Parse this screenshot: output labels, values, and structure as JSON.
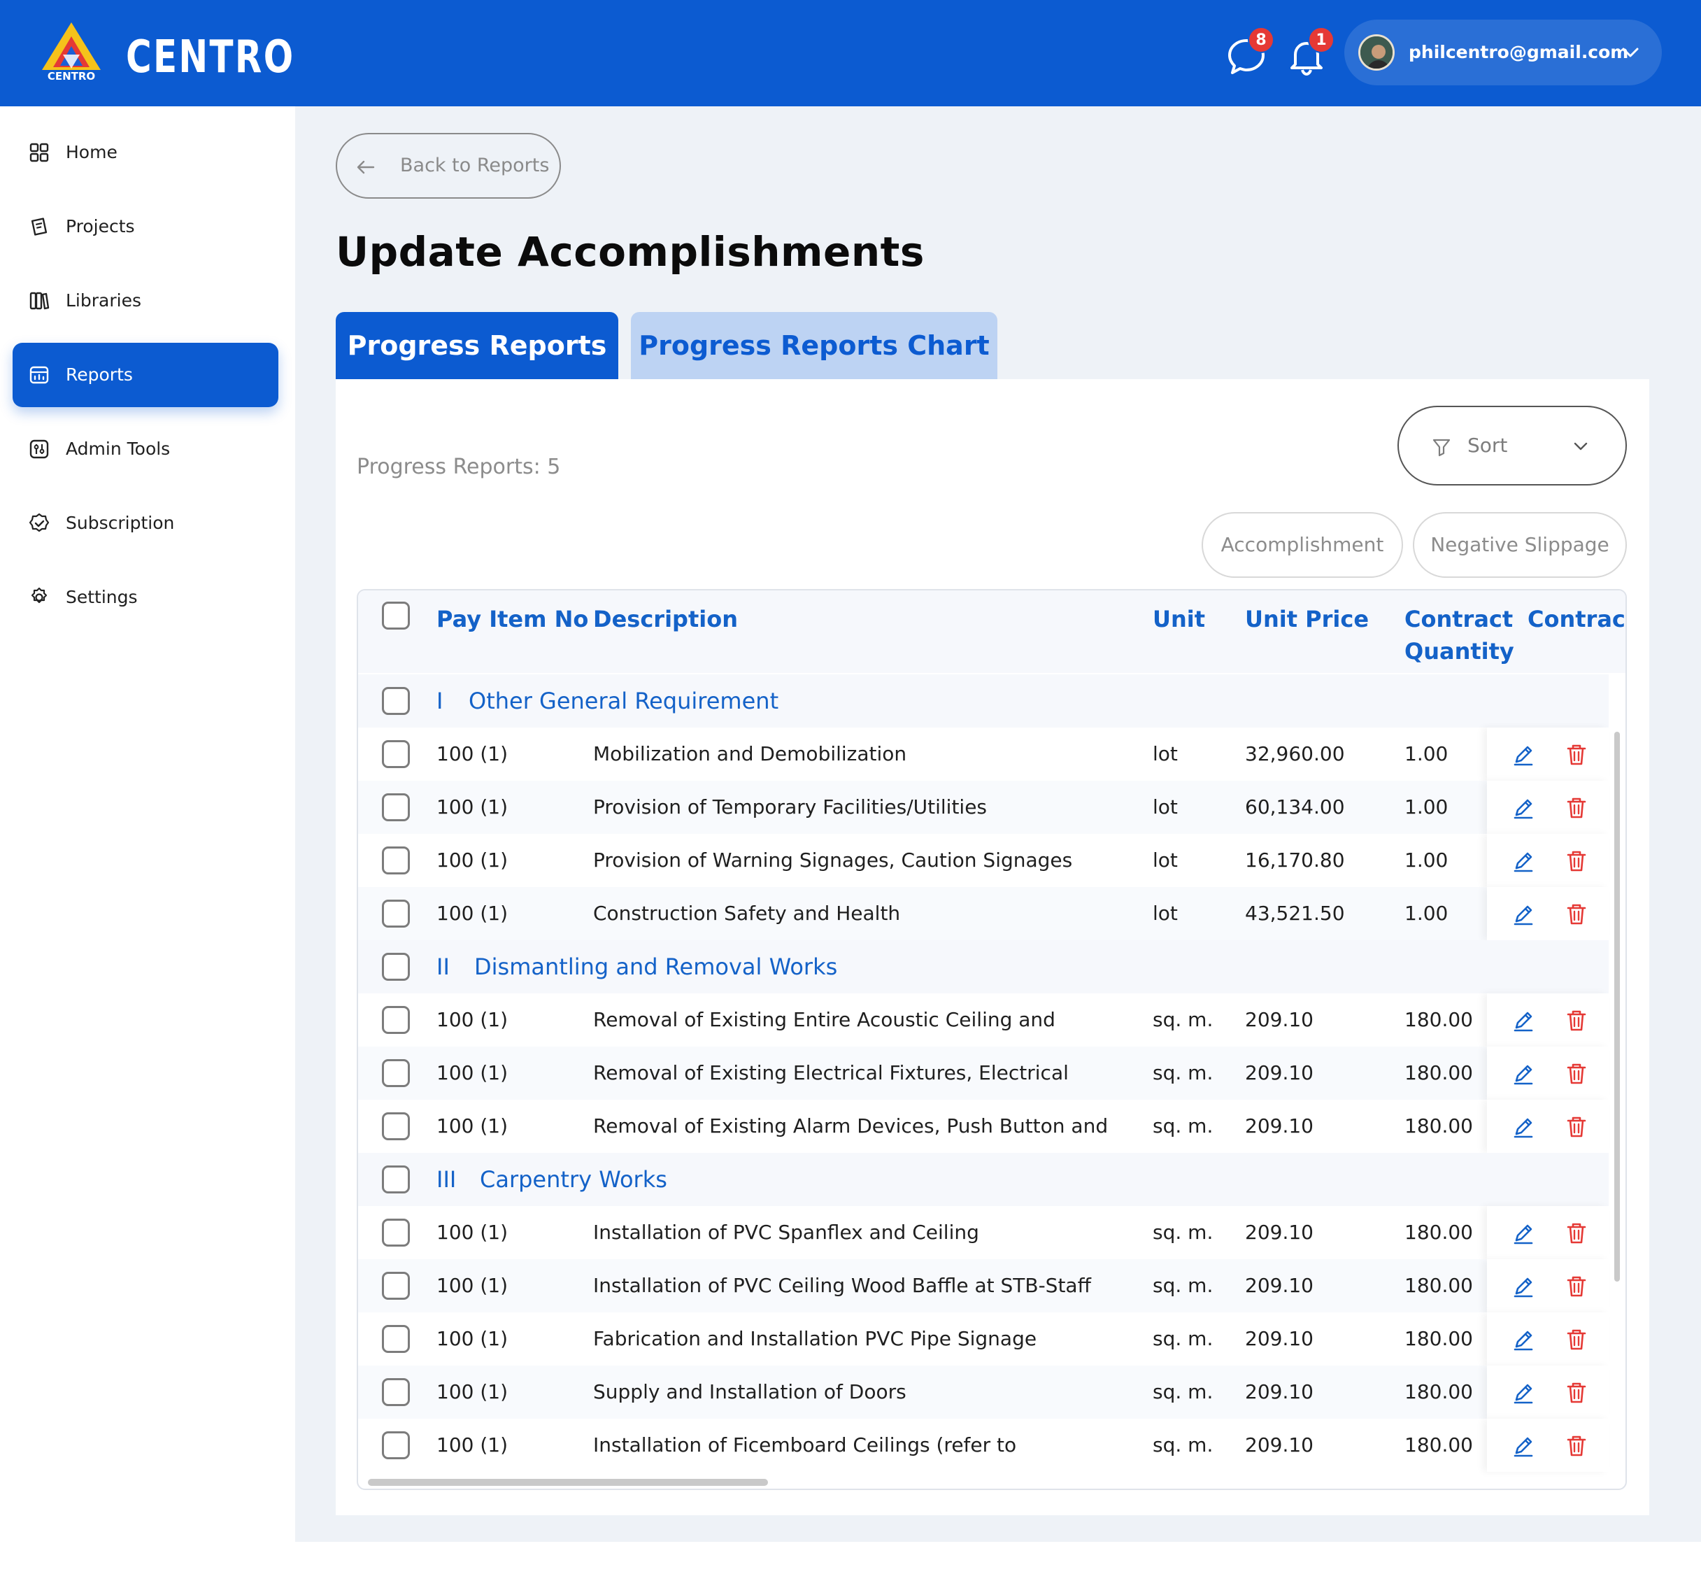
{
  "app": {
    "brand": "CENTRO",
    "logo_text": "CENTRO",
    "colors": {
      "primary": "#0c5bd1",
      "tab_inactive": "#bdd3f3",
      "danger": "#e53935",
      "link_blue": "#1462c8"
    }
  },
  "header": {
    "messages_badge": "8",
    "notifications_badge": "1",
    "user_email": "philcentro@gmail.com",
    "icons": {
      "messages": "chat-bubble-icon",
      "notifications": "bell-icon",
      "menu": "chevron-down-icon"
    }
  },
  "sidebar": {
    "items": [
      {
        "label": "Home",
        "icon": "grid-icon",
        "active": false
      },
      {
        "label": "Projects",
        "icon": "projects-icon",
        "active": false
      },
      {
        "label": "Libraries",
        "icon": "books-icon",
        "active": false
      },
      {
        "label": "Reports",
        "icon": "reports-icon",
        "active": true
      },
      {
        "label": "Admin Tools",
        "icon": "admin-tools-icon",
        "active": false
      },
      {
        "label": "Subscription",
        "icon": "badge-check-icon",
        "active": false
      },
      {
        "label": "Settings",
        "icon": "gear-icon",
        "active": false
      }
    ]
  },
  "main": {
    "back_label": "Back to Reports",
    "title": "Update Accomplishments",
    "tabs": [
      {
        "label": "Progress Reports",
        "active": true
      },
      {
        "label": "Progress Reports Chart",
        "active": false
      }
    ],
    "count_label": "Progress Reports: 5",
    "sort_label": "Sort",
    "filter_buttons": [
      "Accomplishment",
      "Negative Slippage"
    ]
  },
  "table": {
    "headers": {
      "pay_item_no": "Pay Item No",
      "description": "Description",
      "unit": "Unit",
      "unit_price": "Unit Price",
      "contract_quantity_1": "Contract",
      "contract_quantity_2": "Quantity",
      "contract_cut": "Contract"
    },
    "groups": [
      {
        "num": "I",
        "title": "Other General Requirement",
        "rows": [
          {
            "pay_item": "100 (1)",
            "description": "Mobilization and Demobilization",
            "unit": "lot",
            "unit_price": "32,960.00",
            "qty": "1.00"
          },
          {
            "pay_item": "100 (1)",
            "description": "Provision of Temporary Facilities/Utilities",
            "unit": "lot",
            "unit_price": "60,134.00",
            "qty": "1.00"
          },
          {
            "pay_item": "100 (1)",
            "description": "Provision of Warning Signages, Caution Signages",
            "unit": "lot",
            "unit_price": "16,170.80",
            "qty": "1.00"
          },
          {
            "pay_item": "100 (1)",
            "description": "Construction Safety and Health",
            "unit": "lot",
            "unit_price": "43,521.50",
            "qty": "1.00"
          }
        ]
      },
      {
        "num": "II",
        "title": "Dismantling and Removal Works",
        "rows": [
          {
            "pay_item": "100 (1)",
            "description": "Removal of Existing Entire Acoustic Ceiling and",
            "unit": "sq. m.",
            "unit_price": "209.10",
            "qty": "180.00"
          },
          {
            "pay_item": "100 (1)",
            "description": "Removal of Existing Electrical Fixtures, Electrical",
            "unit": "sq. m.",
            "unit_price": "209.10",
            "qty": "180.00"
          },
          {
            "pay_item": "100 (1)",
            "description": "Removal of Existing Alarm Devices, Push Button and",
            "unit": "sq. m.",
            "unit_price": "209.10",
            "qty": "180.00"
          }
        ]
      },
      {
        "num": "III",
        "title": "Carpentry Works",
        "rows": [
          {
            "pay_item": "100 (1)",
            "description": "Installation of PVC Spanflex and Ceiling",
            "unit": "sq. m.",
            "unit_price": "209.10",
            "qty": "180.00"
          },
          {
            "pay_item": "100 (1)",
            "description": "Installation of PVC Ceiling Wood Baffle at STB-Staff",
            "unit": "sq. m.",
            "unit_price": "209.10",
            "qty": "180.00"
          },
          {
            "pay_item": "100 (1)",
            "description": "Fabrication and Installation PVC Pipe Signage",
            "unit": "sq. m.",
            "unit_price": "209.10",
            "qty": "180.00"
          },
          {
            "pay_item": "100 (1)",
            "description": "Supply and Installation of Doors",
            "unit": "sq. m.",
            "unit_price": "209.10",
            "qty": "180.00"
          },
          {
            "pay_item": "100 (1)",
            "description": "Installation of Ficemboard Ceilings (refer to",
            "unit": "sq. m.",
            "unit_price": "209.10",
            "qty": "180.00"
          }
        ]
      }
    ]
  }
}
